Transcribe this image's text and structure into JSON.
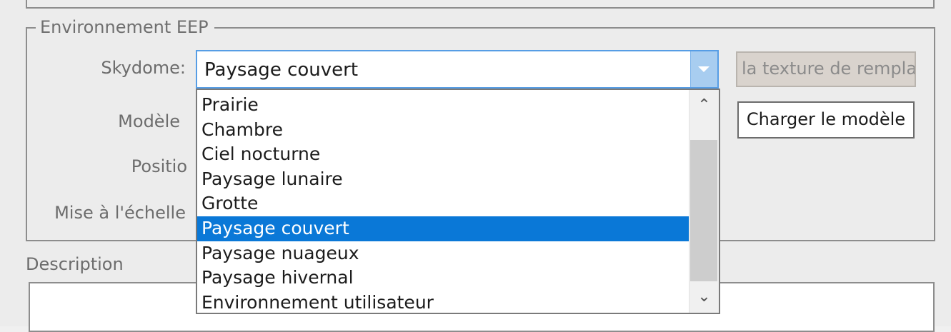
{
  "group": {
    "legend": "Environnement EEP"
  },
  "labels": {
    "skydome": "Skydome:",
    "model": "Modèle",
    "position": "Positio",
    "scale": "Mise à l'échelle",
    "description": "Description"
  },
  "skydome_combo": {
    "selected_value": "Paysage couvert",
    "options": [
      {
        "label": "Prairie",
        "selected": false
      },
      {
        "label": "Chambre",
        "selected": false
      },
      {
        "label": "Ciel nocturne",
        "selected": false
      },
      {
        "label": "Paysage lunaire",
        "selected": false
      },
      {
        "label": "Grotte",
        "selected": false
      },
      {
        "label": "Paysage couvert",
        "selected": true
      },
      {
        "label": "Paysage nuageux",
        "selected": false
      },
      {
        "label": "Paysage hivernal",
        "selected": false
      },
      {
        "label": "Environnement utilisateur",
        "selected": false
      }
    ]
  },
  "buttons": {
    "replace_texture": "la texture de rempla",
    "load_model": "Charger le modèle"
  },
  "scrollbar": {
    "up_icon": "chevron-up-icon",
    "down_icon": "chevron-down-icon"
  },
  "colors": {
    "selection": "#0a78d7",
    "combo_focus_border": "#569de5"
  }
}
